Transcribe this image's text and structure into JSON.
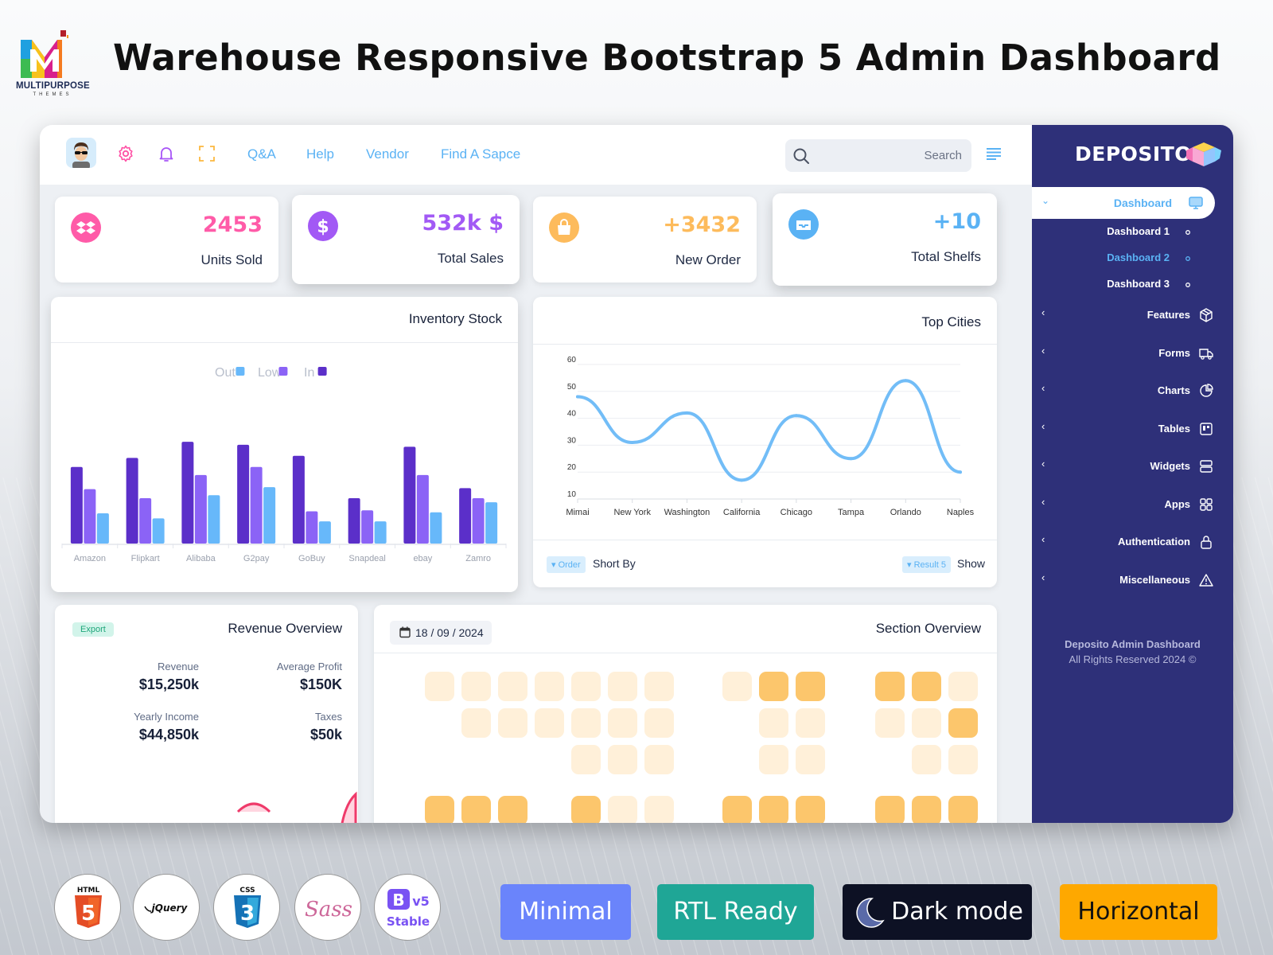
{
  "banner": {
    "brand_name": "MULTIPURPOSE",
    "brand_sub": "THEMES",
    "title": "Warehouse Responsive Bootstrap 5 Admin Dashboard"
  },
  "topbar": {
    "nav": [
      "Q&A",
      "Help",
      "Vendor",
      "Find A Sapce"
    ],
    "search_placeholder": "Search",
    "icons": [
      "avatar",
      "gear-icon",
      "bell-icon",
      "fullscreen-icon",
      "search-icon",
      "menu-icon"
    ],
    "colors": {
      "gear": "#ff4fa4",
      "bell": "#a855f7",
      "fullscreen": "#fbb83f",
      "nav": "#5ab2f4"
    }
  },
  "sidebar": {
    "logo": "DEPOSITO",
    "active": {
      "label": "Dashboard",
      "icon": "monitor-icon"
    },
    "sub_items": [
      {
        "label": "Dashboard 1",
        "active": false
      },
      {
        "label": "Dashboard 2",
        "active": true
      },
      {
        "label": "Dashboard 3",
        "active": false
      }
    ],
    "items": [
      {
        "label": "Features",
        "icon": "box-icon"
      },
      {
        "label": "Forms",
        "icon": "truck-icon"
      },
      {
        "label": "Charts",
        "icon": "pie-chart-icon"
      },
      {
        "label": "Tables",
        "icon": "table-icon"
      },
      {
        "label": "Widgets",
        "icon": "server-icon"
      },
      {
        "label": "Apps",
        "icon": "grid-icon"
      },
      {
        "label": "Authentication",
        "icon": "lock-icon"
      },
      {
        "label": "Miscellaneous",
        "icon": "warning-icon"
      }
    ],
    "footer_title": "Deposito Admin Dashboard",
    "footer_copy": "All Rights Reserved 2024 ©"
  },
  "stats": [
    {
      "value": "2453",
      "label": "Units Sold",
      "color": "#ff5ba8",
      "icon": "dropbox-icon"
    },
    {
      "value": "532k $",
      "label": "Total Sales",
      "color": "#a259f5",
      "icon": "dollar-icon"
    },
    {
      "value": "+3432",
      "label": "New Order",
      "color": "#fdbb5c",
      "icon": "shopping-bag-icon"
    },
    {
      "value": "+10",
      "label": "Total Shelfs",
      "color": "#5ab2f4",
      "icon": "inbox-icon"
    }
  ],
  "inventory": {
    "title": "Inventory Stock"
  },
  "top_cities": {
    "title": "Top Cities",
    "order_pill": "Order",
    "sort_label": "Short By",
    "result_pill": "Result 5",
    "show_label": "Show"
  },
  "revenue": {
    "title": "Revenue Overview",
    "export_label": "Export",
    "metrics": [
      {
        "label": "Revenue",
        "value": "$15,250k"
      },
      {
        "label": "Average Profit",
        "value": "$150K"
      },
      {
        "label": "Yearly Income",
        "value": "$44,850k"
      },
      {
        "label": "Taxes",
        "value": "$50k"
      }
    ]
  },
  "section_overview": {
    "title": "Section Overview",
    "date": "18 / 09 / 2024",
    "colors": {
      "free": "#fff0d9",
      "taken": "#fcc66c"
    },
    "blocks": [
      {
        "rows": [
          [
            1,
            1,
            1,
            1,
            1,
            1,
            1
          ],
          [
            0,
            1,
            1,
            1,
            1,
            1,
            1
          ],
          [
            0,
            0,
            0,
            0,
            1,
            1,
            1
          ],
          [
            2,
            2,
            2,
            0,
            2,
            3,
            3
          ]
        ]
      },
      {
        "rows": [
          [
            1,
            2,
            2
          ],
          [
            0,
            1,
            1
          ],
          [
            0,
            1,
            1
          ],
          [
            2,
            2,
            2
          ]
        ]
      },
      {
        "rows": [
          [
            2,
            2,
            1
          ],
          [
            1,
            1,
            2
          ],
          [
            0,
            1,
            1
          ],
          [
            2,
            2,
            2
          ]
        ]
      }
    ]
  },
  "tech_badges": [
    "HTML 5",
    "jQuery",
    "CSS 3",
    "Sass",
    "Bootstrap v5 Stable"
  ],
  "feature_buttons": [
    {
      "label": "Minimal",
      "bg": "#6a84fb",
      "fg": "#ffffff"
    },
    {
      "label": "RTL Ready",
      "bg": "#1fa696",
      "fg": "#ffffff"
    },
    {
      "label": "Dark mode",
      "bg": "#0d1124",
      "fg": "#ffffff"
    },
    {
      "label": "Horizontal",
      "bg": "#fea800",
      "fg": "#111111"
    }
  ],
  "chart_data": [
    {
      "type": "bar",
      "title": "Inventory Stock",
      "categories": [
        "Amazon",
        "Flipkart",
        "Alibaba",
        "G2pay",
        "GoBuy",
        "Snapdeal",
        "ebay",
        "Zamro"
      ],
      "series": [
        {
          "name": "In",
          "color": "#5b2fc9",
          "values": [
            76,
            85,
            101,
            98,
            87,
            45,
            96,
            55
          ]
        },
        {
          "name": "Low",
          "color": "#8b63f6",
          "values": [
            54,
            45,
            68,
            76,
            32,
            33,
            68,
            45
          ]
        },
        {
          "name": "Out",
          "color": "#67b8fa",
          "values": [
            30,
            25,
            48,
            56,
            22,
            22,
            31,
            41
          ]
        }
      ],
      "legend": [
        "Out",
        "Low",
        "In"
      ],
      "legend_position": "top-center",
      "ylim": [
        0,
        120
      ],
      "grid": false
    },
    {
      "type": "line",
      "title": "Top Cities",
      "categories": [
        "Mimai",
        "New York",
        "Washington",
        "California",
        "Chicago",
        "Tampa",
        "Orlando",
        "Naples"
      ],
      "series": [
        {
          "name": "Cities",
          "color": "#72bdf7",
          "values": [
            48,
            31,
            42,
            17,
            41,
            25,
            54,
            20
          ]
        }
      ],
      "yticks": [
        10,
        20,
        30,
        40,
        50,
        60
      ],
      "ylim": [
        10,
        60
      ],
      "grid": true,
      "smooth": true
    }
  ]
}
